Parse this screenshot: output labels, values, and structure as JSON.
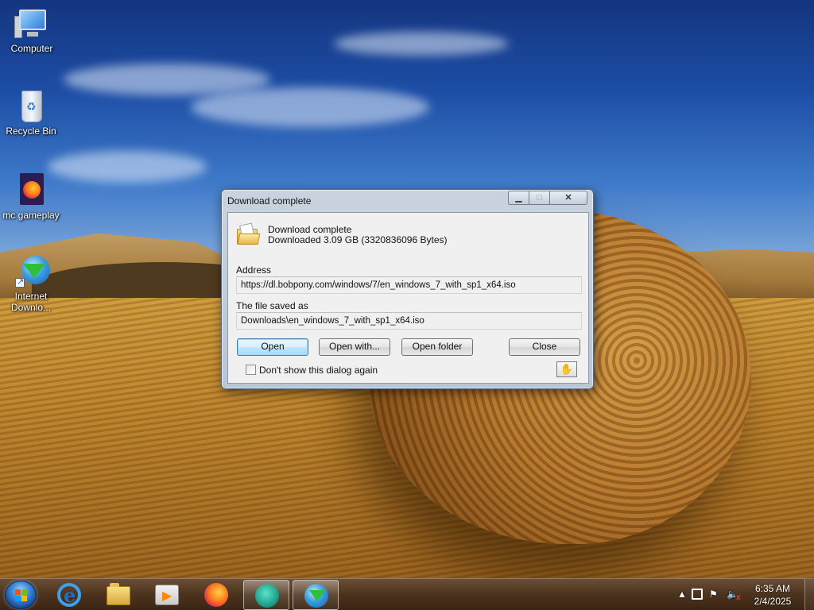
{
  "desktop": {
    "icons": [
      {
        "label": "Computer",
        "icon": "computer-icon"
      },
      {
        "label": "Recycle Bin",
        "icon": "recycle-bin-icon"
      },
      {
        "label": "mc gameplay",
        "icon": "firefox-file-icon"
      },
      {
        "label_line1": "Internet",
        "label_line2": "Downlo...",
        "icon": "internet-download-manager-icon"
      }
    ]
  },
  "dialog": {
    "title": "Download complete",
    "titlebar_buttons": {
      "minimize": "▁",
      "maximize": "□",
      "close": "✕"
    },
    "header_line1": "Download complete",
    "header_line2": "Downloaded 3.09  GB (3320836096 Bytes)",
    "address_label": "Address",
    "address_value": "https://dl.bobpony.com/windows/7/en_windows_7_with_sp1_x64.iso",
    "saved_label": "The file saved as",
    "saved_value": "Downloads\\en_windows_7_with_sp1_x64.iso",
    "buttons": {
      "open": "Open",
      "open_with": "Open with...",
      "open_folder": "Open folder",
      "close": "Close"
    },
    "dont_show_label": "Don't show this dialog again",
    "dont_show_checked": false
  },
  "taskbar": {
    "apps": [
      {
        "name": "internet-explorer",
        "icon": "ie-icon",
        "active": false
      },
      {
        "name": "windows-explorer",
        "icon": "folder-icon",
        "active": false
      },
      {
        "name": "media-player",
        "icon": "media-player-icon",
        "active": false
      },
      {
        "name": "firefox",
        "icon": "firefox-icon",
        "active": false
      },
      {
        "name": "app-blob",
        "icon": "app-icon",
        "active": true
      },
      {
        "name": "internet-download-manager",
        "icon": "idm-icon",
        "active": true
      }
    ],
    "tray": {
      "show_hidden": "▲",
      "flag": "⚑",
      "volume": "🔈",
      "volume_muted_mark": "x"
    },
    "clock": {
      "time": "6:35 AM",
      "date": "2/4/2025"
    }
  },
  "colors": {
    "dialog_frame": "#c9d3de",
    "default_button_border": "#3c7fb1",
    "taskbar": "#5a3a18"
  }
}
